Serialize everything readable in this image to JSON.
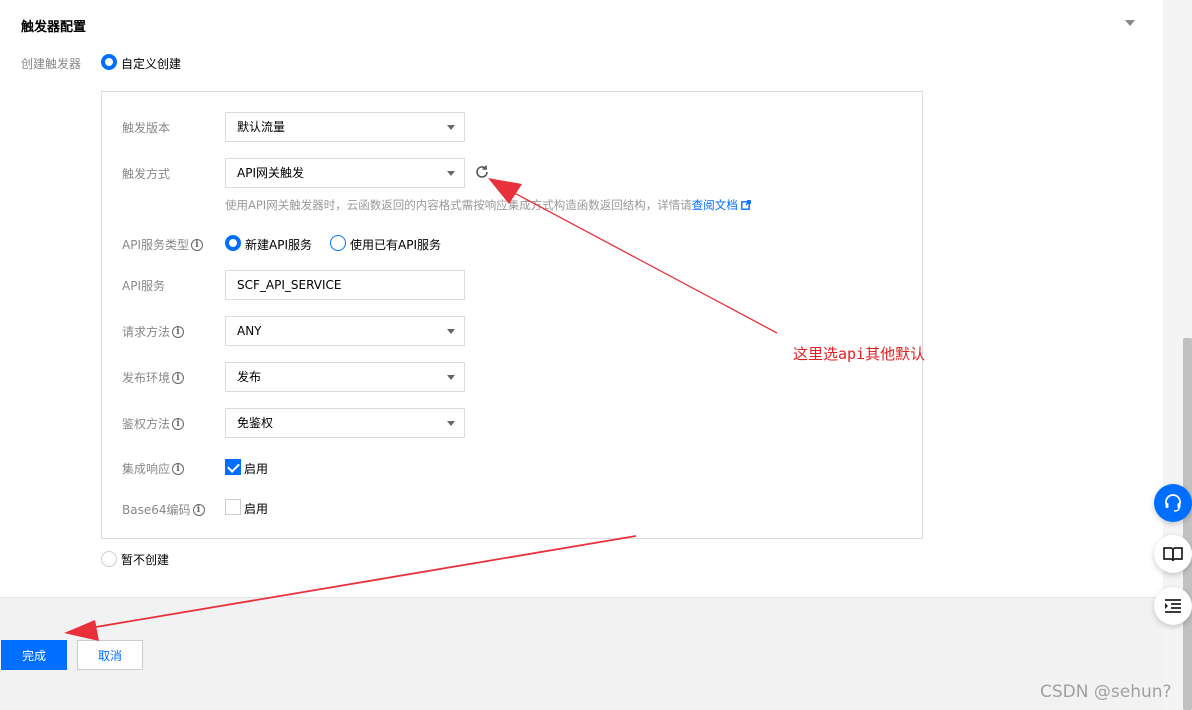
{
  "section": {
    "title": "触发器配置"
  },
  "create_trigger": {
    "label": "创建触发器",
    "custom_option": "自定义创建",
    "skip_option": "暂不创建"
  },
  "form": {
    "version_label": "触发版本",
    "version_value": "默认流量",
    "method_label": "触发方式",
    "method_value": "API网关触发",
    "hint_text": "使用API网关触发器时，云函数返回的内容格式需按响应集成方式构造函数返回结构，详情请",
    "hint_link": "查阅文档",
    "service_type_label": "API服务类型",
    "service_type_new": "新建API服务",
    "service_type_existing": "使用已有API服务",
    "service_label": "API服务",
    "service_value": "SCF_API_SERVICE",
    "request_method_label": "请求方法",
    "request_method_value": "ANY",
    "env_label": "发布环境",
    "env_value": "发布",
    "auth_label": "鉴权方法",
    "auth_value": "免鉴权",
    "integration_label": "集成响应",
    "integration_check": "启用",
    "base64_label": "Base64编码",
    "base64_check": "启用"
  },
  "footer": {
    "confirm": "完成",
    "cancel": "取消"
  },
  "annotation": {
    "text": "这里选api其他默认",
    "color": "#e02020"
  },
  "watermark": "CSDN @sehun?",
  "colors": {
    "accent": "#006eff"
  }
}
